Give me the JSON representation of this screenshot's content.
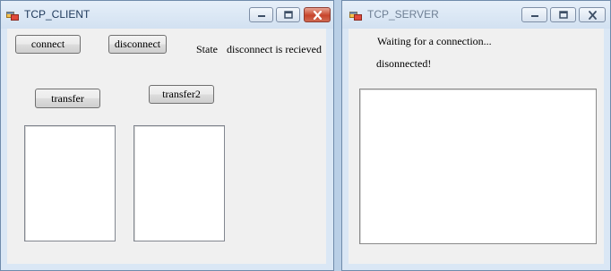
{
  "client": {
    "title": "TCP_CLIENT",
    "icons": {
      "app": "app-window-icon",
      "minimize": "minimize-icon",
      "maximize": "maximize-icon",
      "close": "close-icon"
    },
    "buttons": {
      "connect": "connect",
      "disconnect": "disconnect",
      "transfer": "transfer",
      "transfer2": "transfer2"
    },
    "state_label": "State",
    "state_value": "disconnect is recieved"
  },
  "server": {
    "title": "TCP_SERVER",
    "icons": {
      "app": "app-window-icon",
      "minimize": "minimize-icon",
      "maximize": "maximize-icon",
      "close": "close-icon"
    },
    "status_line1": "Waiting for a connection...",
    "status_line2": "disonnected!"
  },
  "colors": {
    "frame": "#dae7f5",
    "client_area": "#f0f0f0",
    "close_button": "#c7452d",
    "title_text": "#1e395b"
  }
}
